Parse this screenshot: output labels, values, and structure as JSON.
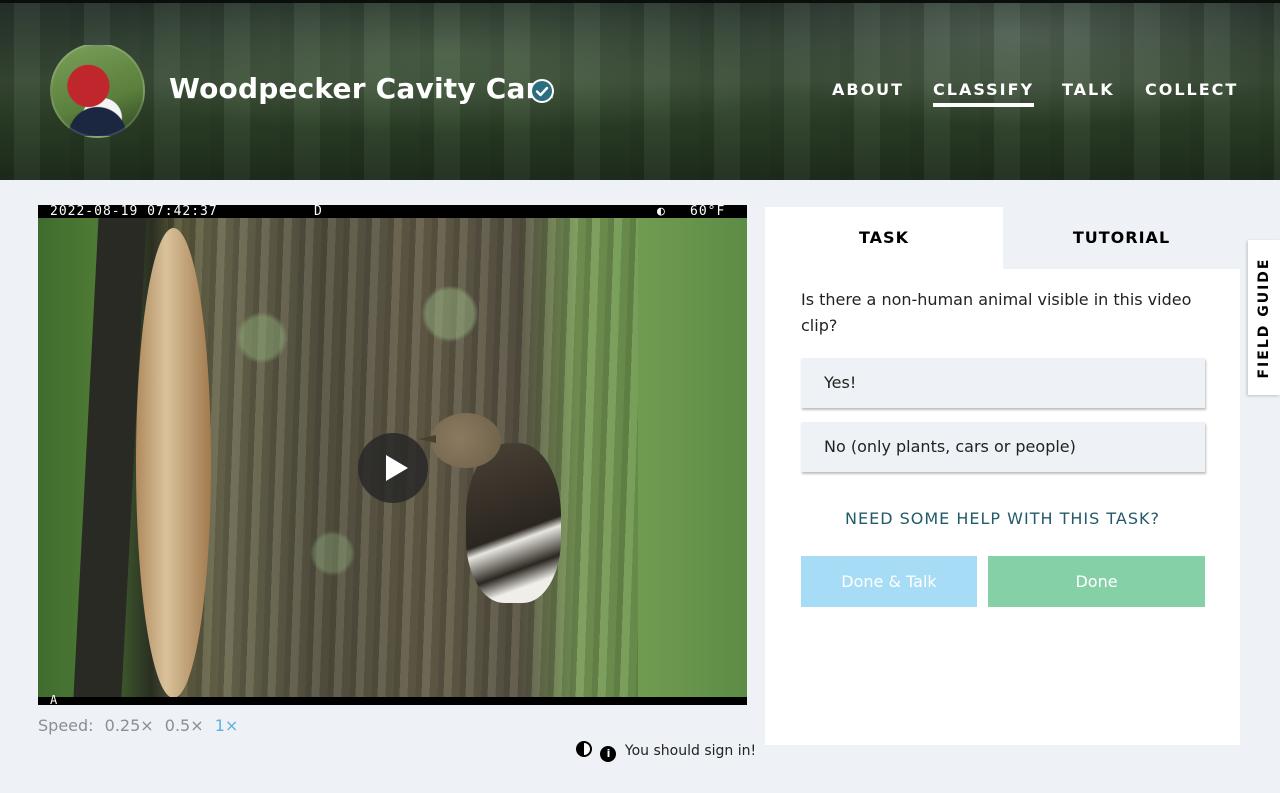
{
  "header": {
    "project_title": "Woodpecker Cavity Cam",
    "verified_icon": "check-badge-icon",
    "nav": {
      "about": "ABOUT",
      "classify": "CLASSIFY",
      "talk": "TALK",
      "collect": "COLLECT"
    },
    "active_nav": "CLASSIFY"
  },
  "video": {
    "timestamp": "2022-08-19 07:42:37",
    "mode": "D",
    "moon_icon": "◐",
    "temperature": "60°F",
    "corner_marker": "A",
    "play_icon": "play-icon"
  },
  "speed": {
    "label": "Speed:",
    "options": [
      "0.25×",
      "0.5×",
      "1×"
    ],
    "selected": "1×"
  },
  "footer": {
    "sign_in_text": "You should sign in!",
    "info_icon_glyph": "i"
  },
  "task_panel": {
    "tabs": {
      "task": "TASK",
      "tutorial": "TUTORIAL"
    },
    "question": "Is there a non-human animal visible in this video clip?",
    "answers": {
      "yes": "Yes!",
      "no": "No (only plants, cars or people)"
    },
    "help_link": "NEED SOME HELP WITH THIS TASK?",
    "buttons": {
      "done_talk": "Done & Talk",
      "done": "Done"
    }
  },
  "field_guide": {
    "label": "FIELD GUIDE"
  },
  "colors": {
    "background": "#eef1f5",
    "done_talk_button": "#a6dcf5",
    "done_button": "#86d0a8",
    "help_link": "#235a6a",
    "speed_active": "#5bb3de"
  }
}
